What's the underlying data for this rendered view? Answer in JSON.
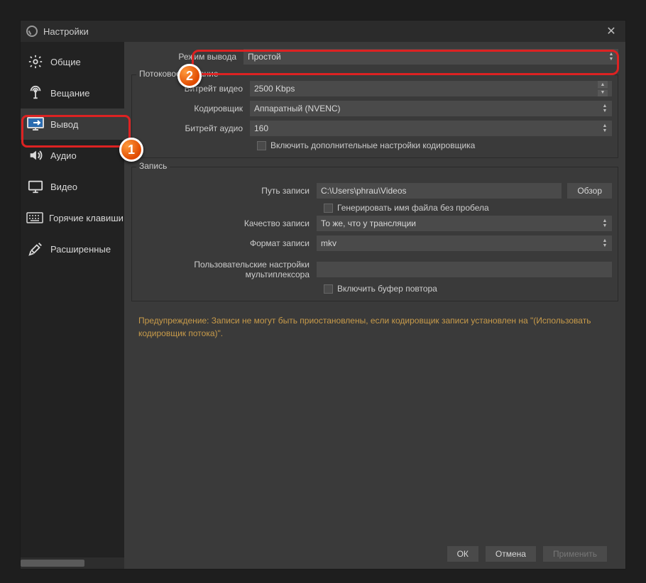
{
  "window": {
    "title": "Настройки"
  },
  "sidebar": {
    "items": [
      {
        "label": "Общие"
      },
      {
        "label": "Вещание"
      },
      {
        "label": "Вывод"
      },
      {
        "label": "Аудио"
      },
      {
        "label": "Видео"
      },
      {
        "label": "Горячие клавиши"
      },
      {
        "label": "Расширенные"
      }
    ]
  },
  "mode": {
    "label": "Режим вывода",
    "value": "Простой"
  },
  "streaming": {
    "title": "Потоковое вещание",
    "video_bitrate_label": "Битрейт видео",
    "video_bitrate_value": "2500 Kbps",
    "encoder_label": "Кодировщик",
    "encoder_value": "Аппаратный (NVENC)",
    "audio_bitrate_label": "Битрейт аудио",
    "audio_bitrate_value": "160",
    "advanced_cb": "Включить дополнительные настройки кодировщика"
  },
  "recording": {
    "title": "Запись",
    "path_label": "Путь записи",
    "path_value": "C:\\Users\\phrau\\Videos",
    "browse": "Обзор",
    "gen_name_cb": "Генерировать имя файла без пробела",
    "quality_label": "Качество записи",
    "quality_value": "То же, что у трансляции",
    "format_label": "Формат записи",
    "format_value": "mkv",
    "mux_label": "Пользовательские настройки мультиплексора",
    "replay_cb": "Включить буфер повтора"
  },
  "warning": "Предупреждение: Записи не могут быть приостановлены, если кодировщик записи установлен на \"(Использовать кодировщик потока)\".",
  "footer": {
    "ok": "ОК",
    "cancel": "Отмена",
    "apply": "Применить"
  },
  "badges": {
    "one": "1",
    "two": "2"
  }
}
